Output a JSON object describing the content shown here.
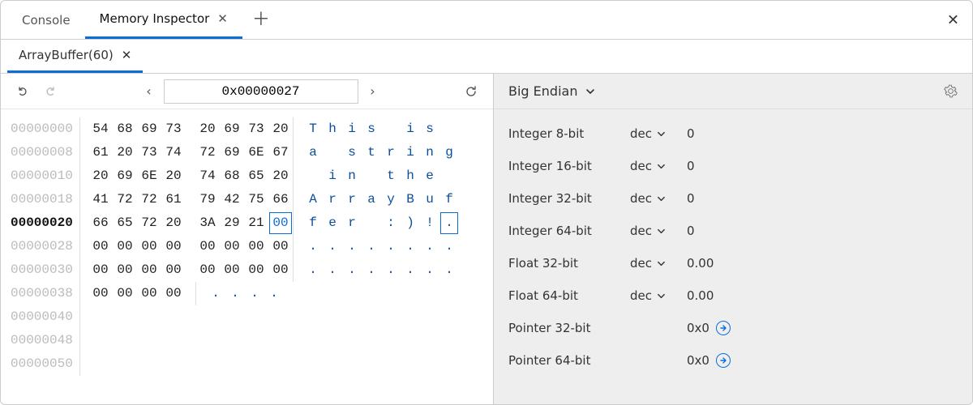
{
  "tabs": {
    "console": "Console",
    "memory": "Memory Inspector"
  },
  "subtab": "ArrayBuffer(60)",
  "address_input": "0x00000027",
  "endian_label": "Big Endian",
  "hex_rows": [
    {
      "offset": "00000000",
      "current": false,
      "bytes": [
        "54",
        "68",
        "69",
        "73",
        "20",
        "69",
        "73",
        "20"
      ],
      "ascii": [
        "T",
        "h",
        "i",
        "s",
        " ",
        "i",
        "s",
        " "
      ],
      "sel": -1
    },
    {
      "offset": "00000008",
      "current": false,
      "bytes": [
        "61",
        "20",
        "73",
        "74",
        "72",
        "69",
        "6E",
        "67"
      ],
      "ascii": [
        "a",
        " ",
        "s",
        "t",
        "r",
        "i",
        "n",
        "g"
      ],
      "sel": -1
    },
    {
      "offset": "00000010",
      "current": false,
      "bytes": [
        "20",
        "69",
        "6E",
        "20",
        "74",
        "68",
        "65",
        "20"
      ],
      "ascii": [
        " ",
        "i",
        "n",
        " ",
        "t",
        "h",
        "e",
        " "
      ],
      "sel": -1
    },
    {
      "offset": "00000018",
      "current": false,
      "bytes": [
        "41",
        "72",
        "72",
        "61",
        "79",
        "42",
        "75",
        "66"
      ],
      "ascii": [
        "A",
        "r",
        "r",
        "a",
        "y",
        "B",
        "u",
        "f"
      ],
      "sel": -1
    },
    {
      "offset": "00000020",
      "current": true,
      "bytes": [
        "66",
        "65",
        "72",
        "20",
        "3A",
        "29",
        "21",
        "00"
      ],
      "ascii": [
        "f",
        "e",
        "r",
        " ",
        ":",
        ")",
        "!",
        "."
      ],
      "sel": 7
    },
    {
      "offset": "00000028",
      "current": false,
      "bytes": [
        "00",
        "00",
        "00",
        "00",
        "00",
        "00",
        "00",
        "00"
      ],
      "ascii": [
        ".",
        ".",
        ".",
        ".",
        ".",
        ".",
        ".",
        "."
      ],
      "sel": -1
    },
    {
      "offset": "00000030",
      "current": false,
      "bytes": [
        "00",
        "00",
        "00",
        "00",
        "00",
        "00",
        "00",
        "00"
      ],
      "ascii": [
        ".",
        ".",
        ".",
        ".",
        ".",
        ".",
        ".",
        "."
      ],
      "sel": -1
    },
    {
      "offset": "00000038",
      "current": false,
      "bytes": [
        "00",
        "00",
        "00",
        "00"
      ],
      "ascii": [
        ".",
        ".",
        ".",
        "."
      ],
      "sel": -1
    },
    {
      "offset": "00000040",
      "current": false,
      "bytes": [],
      "ascii": [],
      "sel": -1
    },
    {
      "offset": "00000048",
      "current": false,
      "bytes": [],
      "ascii": [],
      "sel": -1
    },
    {
      "offset": "00000050",
      "current": false,
      "bytes": [],
      "ascii": [],
      "sel": -1
    }
  ],
  "values": [
    {
      "label": "Integer 8-bit",
      "fmt": "dec",
      "val": "0"
    },
    {
      "label": "Integer 16-bit",
      "fmt": "dec",
      "val": "0"
    },
    {
      "label": "Integer 32-bit",
      "fmt": "dec",
      "val": "0"
    },
    {
      "label": "Integer 64-bit",
      "fmt": "dec",
      "val": "0"
    },
    {
      "label": "Float 32-bit",
      "fmt": "dec",
      "val": "0.00"
    },
    {
      "label": "Float 64-bit",
      "fmt": "dec",
      "val": "0.00"
    },
    {
      "label": "Pointer 32-bit",
      "fmt": "",
      "val": "0x0",
      "go": true
    },
    {
      "label": "Pointer 64-bit",
      "fmt": "",
      "val": "0x0",
      "go": true
    }
  ]
}
